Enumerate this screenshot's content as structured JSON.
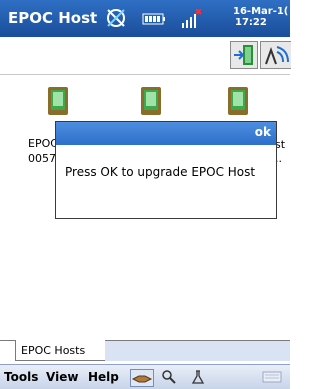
{
  "titlebar": {
    "title": "EPOC Host",
    "date": "16-Mar-1(",
    "time": "17:22"
  },
  "devices": [
    {
      "label_line1": "EPOC",
      "label_line2": "0057"
    },
    {
      "label_line1": "",
      "label_line2": ""
    },
    {
      "label_line1": "st",
      "label_line2": ".."
    }
  ],
  "dialog": {
    "ok_label": "ok",
    "message": "Press OK to upgrade EPOC Host"
  },
  "tabs": [
    {
      "label": "EPOC Hosts"
    }
  ],
  "menubar": {
    "tools": "Tools",
    "view": "View",
    "help": "Help"
  },
  "colors": {
    "titlebar": "#1a4d9a",
    "dialog_header": "#2d6fca",
    "menubar": "#c8d4ea"
  }
}
